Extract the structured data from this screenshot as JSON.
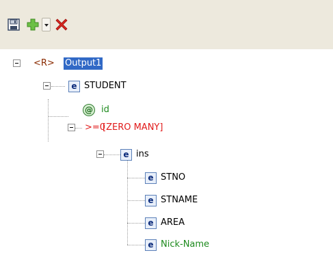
{
  "toolbar": {
    "buttons": [
      {
        "name": "save",
        "icon": "save-disk-icon"
      },
      {
        "name": "add",
        "icon": "add-plus-icon"
      },
      {
        "name": "dropdown",
        "icon": "chevron-down-icon"
      },
      {
        "name": "delete",
        "icon": "delete-x-icon"
      }
    ],
    "colors": {
      "background": "#ede9dd",
      "add": "#5ab334",
      "delete": "#d7261f"
    }
  },
  "tree": {
    "root": {
      "tag": "<R>",
      "label": "Output1",
      "selected": true
    },
    "student": {
      "icon": "e",
      "label": "STUDENT"
    },
    "id_attr": {
      "icon": "@",
      "label": "id"
    },
    "group": {
      "cardinality": ">=0",
      "label": "[ZERO MANY]"
    },
    "ins": {
      "icon": "e",
      "label": "ins"
    },
    "children": [
      {
        "icon": "e",
        "label": "STNO"
      },
      {
        "icon": "e",
        "label": "STNAME"
      },
      {
        "icon": "e",
        "label": "AREA"
      },
      {
        "icon": "e",
        "label": "Nick-Name"
      }
    ],
    "colors": {
      "selection": "#3169c6",
      "green": "#1d8a1d",
      "red": "#e11a1a"
    }
  }
}
